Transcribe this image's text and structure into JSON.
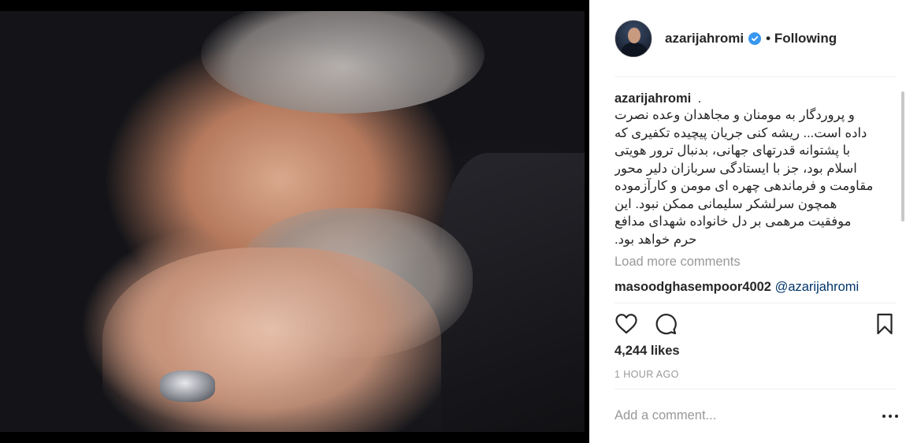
{
  "post": {
    "author": "azarijahromi",
    "verified": true,
    "follow_status": "Following",
    "separator": "•"
  },
  "caption": {
    "username": "azarijahromi",
    "lead": ".",
    "text": "و پروردگار به مومنان و مجاهدان وعده نصرت داده است... ریشه کنی جریان پیچیده تکفیری که با پشتوانه قدرتهای جهانی، بدنبال ترور هویتی اسلام بود، جز با ایستادگی سربازان دلیر محور مقاومت و فرماندهی چهره ای مومن و کارآزموده همچون سرلشکر سلیمانی ممکن نبود. این موفقیت مرهمی بر دل خانواده شهدای مدافع حرم خواهد بود."
  },
  "load_more": "Load more comments",
  "comments": [
    {
      "username": "masoodghasempoor4002",
      "mention": "@azarijahromi"
    }
  ],
  "actions": {
    "like_icon": "heart-icon",
    "comment_icon": "comment-bubble-icon",
    "save_icon": "bookmark-icon"
  },
  "likes": "4,244 likes",
  "timestamp": "1 HOUR AGO",
  "add_comment": {
    "placeholder": "Add a comment..."
  },
  "colors": {
    "verified_badge": "#3897f0",
    "mention": "#003569",
    "muted": "#999999",
    "text": "#262626"
  }
}
